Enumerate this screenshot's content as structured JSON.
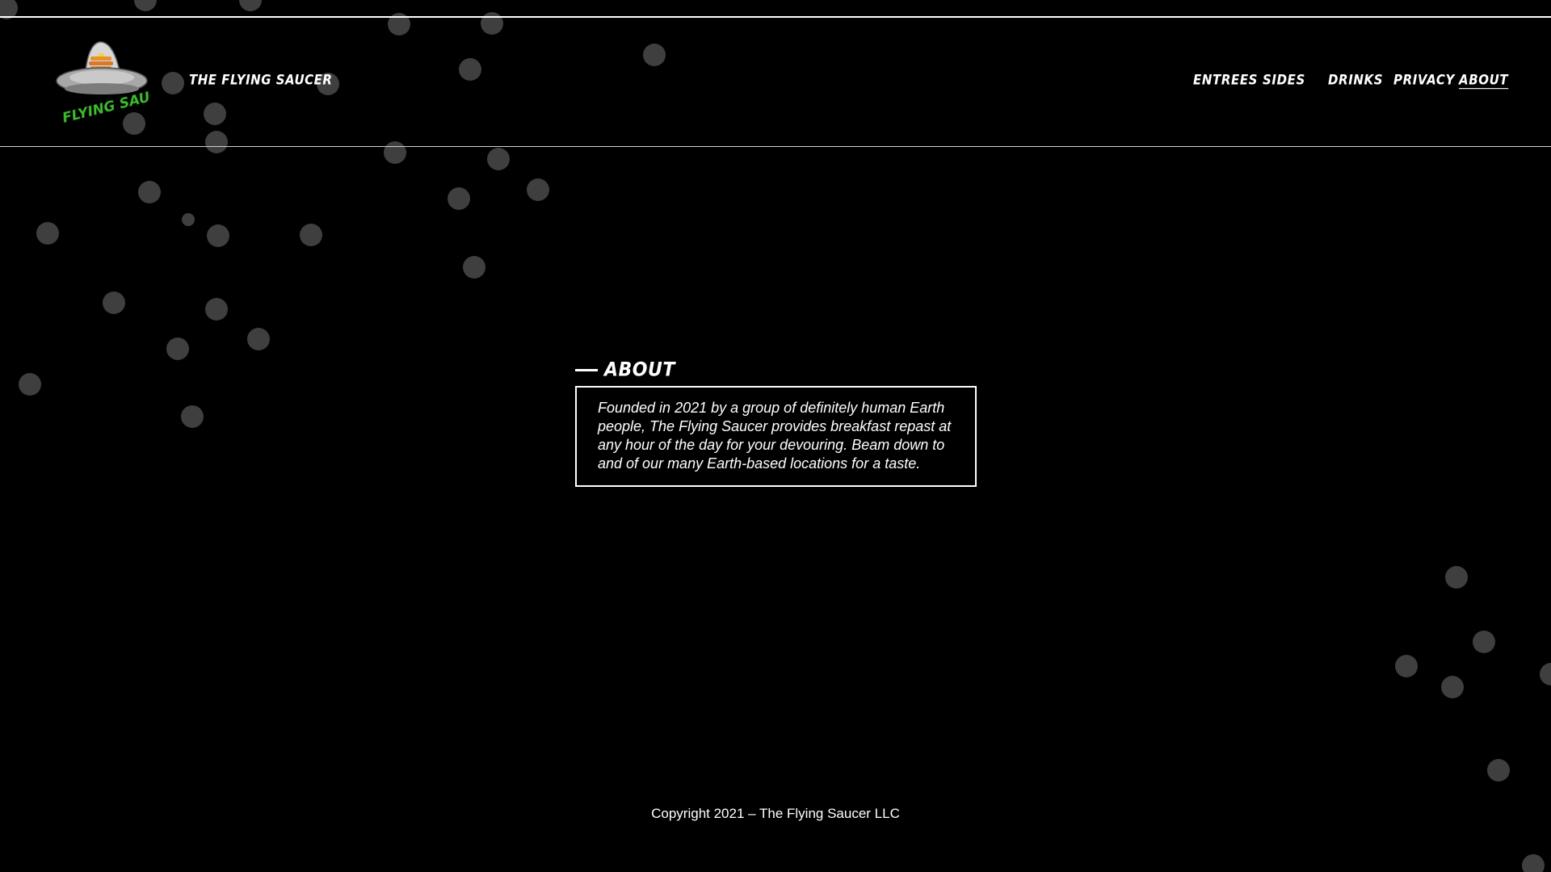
{
  "header": {
    "site_title": "THE FLYING SAUCER",
    "logo_text": "FLYING SAUCER"
  },
  "nav": {
    "items": [
      "ENTREES",
      "SIDES",
      "DRINKS",
      "PRIVACY",
      "ABOUT"
    ],
    "active": "ABOUT"
  },
  "about": {
    "title": "ABOUT",
    "body": "Founded in 2021 by a group of definitely human Earth people, The Flying Saucer provides breakfast repast at any hour of the day for your devouring. Beam down to and of our many Earth-based locations for a taste."
  },
  "footer": {
    "copyright": "Copyright 2021 – The Flying Saucer LLC"
  },
  "colors": {
    "background": "#000000",
    "text": "#ffffff",
    "bubble": "#4a4a4a",
    "logo_green": "#3fbf2f",
    "saucer_gray": "#9a9a9a",
    "saucer_orange": "#e8902a"
  }
}
